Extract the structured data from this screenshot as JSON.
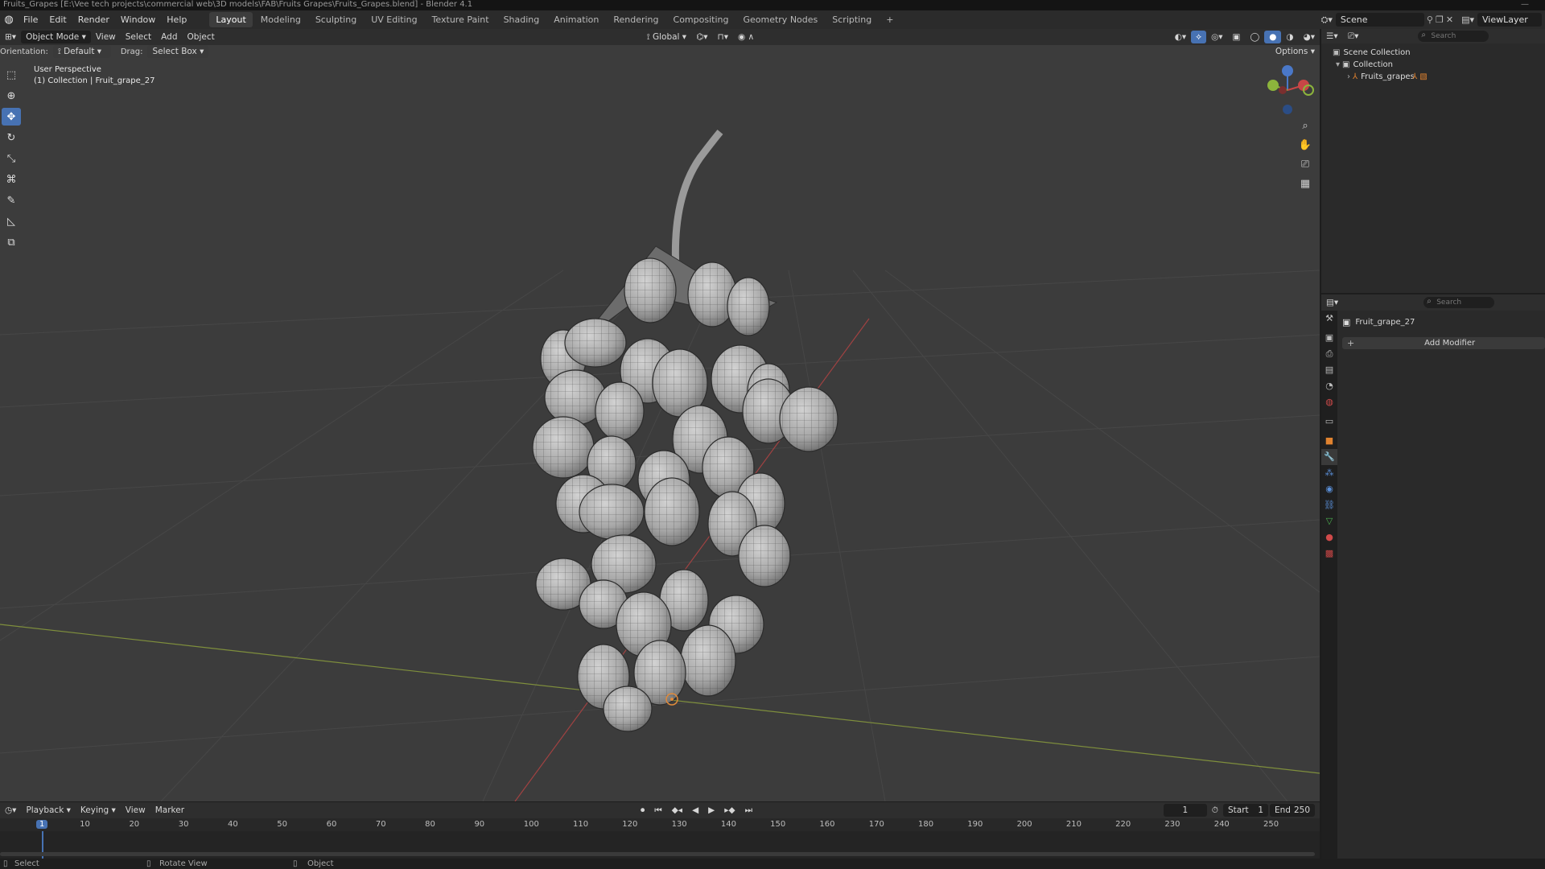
{
  "window": {
    "title": "Fruits_Grapes [E:\\Vee tech projects\\commercial web\\3D models\\FAB\\Fruits Grapes\\Fruits_Grapes.blend] - Blender 4.1",
    "minimize_glyph": "—"
  },
  "topbar": {
    "menus": [
      "File",
      "Edit",
      "Render",
      "Window",
      "Help"
    ],
    "workspaces": [
      "Layout",
      "Modeling",
      "Sculpting",
      "UV Editing",
      "Texture Paint",
      "Shading",
      "Animation",
      "Rendering",
      "Compositing",
      "Geometry Nodes",
      "Scripting"
    ],
    "active_workspace": "Layout",
    "add_tab": "+",
    "scene": "Scene",
    "view_layer": "ViewLayer"
  },
  "viewport_header": {
    "mode": "Object Mode",
    "menus": [
      "View",
      "Select",
      "Add",
      "Object"
    ],
    "transform_orientation": "Global",
    "options": "Options",
    "orientation_label": "Orientation:",
    "orientation_value": "Default",
    "drag_label": "Drag:",
    "drag_value": "Select Box"
  },
  "viewport": {
    "perspective": "User Perspective",
    "collection_info": "(1) Collection | Fruit_grape_27",
    "gizmo_axes": [
      "X",
      "Y",
      "Z"
    ]
  },
  "toolbar": {
    "tools": [
      {
        "name": "select-box",
        "icon": "cursor-select-icon"
      },
      {
        "name": "cursor",
        "icon": "3d-cursor-icon"
      },
      {
        "name": "move",
        "icon": "move-icon"
      },
      {
        "name": "rotate",
        "icon": "rotate-icon"
      },
      {
        "name": "scale",
        "icon": "scale-icon"
      },
      {
        "name": "transform",
        "icon": "transform-icon"
      },
      {
        "name": "annotate",
        "icon": "annotate-icon"
      },
      {
        "name": "measure",
        "icon": "measure-icon"
      },
      {
        "name": "add-cube",
        "icon": "add-cube-icon"
      }
    ],
    "active_tool": "move"
  },
  "outliner": {
    "search_placeholder": "Search",
    "items": [
      {
        "label": "Scene Collection",
        "depth": 0
      },
      {
        "label": "Collection",
        "depth": 1
      },
      {
        "label": "Fruits_grapes",
        "depth": 2
      }
    ]
  },
  "properties": {
    "search_placeholder": "Search",
    "object_name": "Fruit_grape_27",
    "add_modifier": "Add Modifier",
    "tabs": [
      "tool-icon",
      "render-icon",
      "output-icon",
      "view-layer-icon",
      "scene-icon",
      "world-icon",
      "collection-icon",
      "object-icon",
      "modifier-icon",
      "particles-icon",
      "physics-icon",
      "constraints-icon",
      "data-icon",
      "material-icon",
      "texture-icon"
    ],
    "active_tab": "modifier-icon"
  },
  "timeline": {
    "menus": [
      "Playback",
      "Keying",
      "View",
      "Marker"
    ],
    "current_frame": "1",
    "start_label": "Start",
    "start": "1",
    "end_label": "End",
    "end": "250",
    "ruler_ticks": [
      "1",
      "10",
      "20",
      "30",
      "40",
      "50",
      "60",
      "70",
      "80",
      "90",
      "100",
      "110",
      "120",
      "130",
      "140",
      "150",
      "160",
      "170",
      "180",
      "190",
      "200",
      "210",
      "220",
      "230",
      "240",
      "250"
    ]
  },
  "statusbar": {
    "items": [
      "Select",
      "Rotate View",
      "Object"
    ]
  },
  "colors": {
    "accent": "#4772b3",
    "viewport_bg": "#3c3c3c",
    "panel_bg": "#2a2a2a",
    "x_axis": "#c84646",
    "y_axis": "#8cb43c",
    "z_axis": "#4a78c8",
    "object_orange": "#e0822f"
  }
}
